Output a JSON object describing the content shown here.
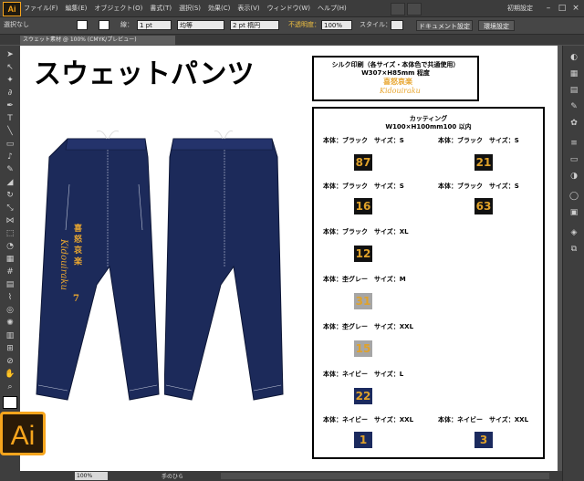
{
  "app": {
    "logo": "Ai",
    "big_logo": "Ai"
  },
  "menubar": {
    "items": [
      "ファイル(F)",
      "編集(E)",
      "オブジェクト(O)",
      "書式(T)",
      "選択(S)",
      "効果(C)",
      "表示(V)",
      "ウィンドウ(W)",
      "ヘルプ(H)"
    ],
    "workspace": "初期設定",
    "window_controls": [
      "–",
      "□",
      "×"
    ]
  },
  "control_bar": {
    "selection": "選択なし",
    "stroke_label": "線：",
    "stroke_value": "1 pt",
    "stroke_style": "均等",
    "brush": "2 pt 楕円",
    "opacity_label": "不透明度：",
    "opacity_value": "100%",
    "style_label": "スタイル：",
    "document_setup": "ドキュメント設定",
    "preferences": "環境設定"
  },
  "document_tab": {
    "title": "スウェット素材 @ 100% (CMYK/プレビュー)"
  },
  "status_bar": {
    "zoom": "100%",
    "tool_label": "手のひら"
  },
  "artwork": {
    "title": "スウェットパンツ",
    "silk": {
      "heading": "シルク印刷（各サイズ・本体色で共通使用）",
      "size": "W307×H85mm 程度",
      "logo_kanji": "喜怒哀楽",
      "logo_roman": "Kidouiraku"
    },
    "pants_print": {
      "kanji": "喜 怒 哀 楽",
      "roman": "Kidouiraku",
      "number": "7"
    },
    "cutting": {
      "heading": "カッティング",
      "size": "W100×H100mm100 以内",
      "items": [
        {
          "label": "本体：ブラック　サイズ：S",
          "number": "87",
          "bg": "#111111",
          "fg": "#e0a22a"
        },
        {
          "label": "本体：ブラック　サイズ：S",
          "number": "21",
          "bg": "#111111",
          "fg": "#e0a22a"
        },
        {
          "label": "本体：ブラック　サイズ：S",
          "number": "16",
          "bg": "#111111",
          "fg": "#e0a22a"
        },
        {
          "label": "本体：ブラック　サイズ：S",
          "number": "63",
          "bg": "#111111",
          "fg": "#e0a22a"
        },
        {
          "label": "本体：ブラック　サイズ：XL",
          "number": "12",
          "bg": "#111111",
          "fg": "#e0a22a"
        },
        {
          "label": "本体：杢グレー　サイズ：M",
          "number": "31",
          "bg": "#a6a6a6",
          "fg": "#e0a22a"
        },
        {
          "label": "本体：杢グレー　サイズ：XXL",
          "number": "15",
          "bg": "#a6a6a6",
          "fg": "#e0a22a"
        },
        {
          "label": "本体：ネイビー　サイズ：L",
          "number": "22",
          "bg": "#1b2a5e",
          "fg": "#e0a22a"
        },
        {
          "label": "本体：ネイビー　サイズ：XXL",
          "number": "1",
          "bg": "#1b2a5e",
          "fg": "#e0a22a"
        },
        {
          "label": "本体：ネイビー　サイズ：XXL",
          "number": "3",
          "bg": "#1b2a5e",
          "fg": "#e0a22a"
        }
      ]
    }
  },
  "colors": {
    "navy": "#1c2a5a",
    "gold": "#e0a22a",
    "ai_orange": "#f7a51d"
  }
}
